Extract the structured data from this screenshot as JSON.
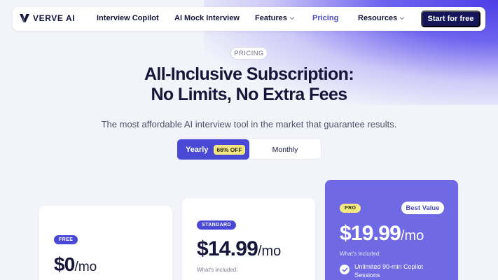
{
  "brand": {
    "name": "VERVE AI",
    "accent": "#4a49d6",
    "dark": "#15165a",
    "highlight": "#f3e782"
  },
  "nav": {
    "items": [
      {
        "label": "Interview Copilot"
      },
      {
        "label": "AI Mock Interview"
      },
      {
        "label": "Features"
      },
      {
        "label": "Pricing"
      },
      {
        "label": "Resources"
      }
    ],
    "cta_label": "Start for free"
  },
  "hero": {
    "tag": "PRICING",
    "title_line1": "All-Inclusive Subscription:",
    "title_line2": "No Limits, No Extra Fees",
    "subtitle": "The most affordable AI interview tool in the market that guarantee results."
  },
  "billing_toggle": {
    "yearly_label": "Yearly",
    "discount_badge": "66% OFF",
    "monthly_label": "Monthly",
    "selected": "Yearly"
  },
  "plans": [
    {
      "tier": "FREE",
      "price": "$0",
      "per": "/mo"
    },
    {
      "tier": "STANDARD",
      "price": "$14.99",
      "per": "/mo",
      "included_label": "What's included:"
    },
    {
      "tier": "PRO",
      "price": "$19.99",
      "per": "/mo",
      "included_label": "What's included:",
      "badge": "Best Value",
      "features": [
        "Unlimited 90-min Copilot Sessions"
      ]
    }
  ]
}
